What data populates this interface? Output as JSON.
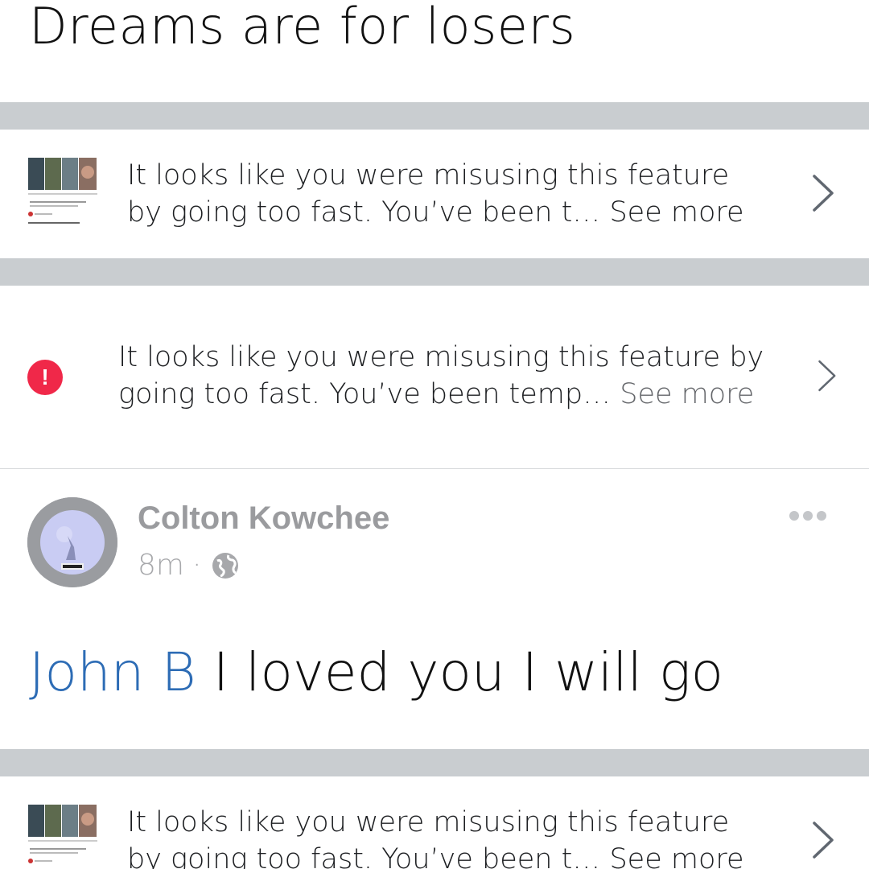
{
  "story": {
    "headline": "Dreams are for losers"
  },
  "notices": [
    {
      "text": "It looks like you were misusing this feature by going too fast. You’ve been t…",
      "see_more": "See more"
    },
    {
      "text": "It looks like you were misusing this feature by going too fast. You’ve been temp…",
      "see_more": "See more"
    },
    {
      "text": "It looks like you were misusing this feature by going too fast. You’ve been t…",
      "see_more": "See more"
    }
  ],
  "post": {
    "author": "Colton Kowchee",
    "time": "8m",
    "separator": "·",
    "audience_icon": "globe-icon",
    "mention": "John B",
    "body": "I loved you I will go"
  },
  "icons": {
    "alert": "!",
    "chevron": "chevron-right-icon",
    "more": "more-horizontal-icon"
  },
  "colors": {
    "divider": "#c9cdd0",
    "alert_red": "#f02849",
    "mention_blue": "#2d6cb5",
    "muted_text": "#9a9b9e"
  }
}
